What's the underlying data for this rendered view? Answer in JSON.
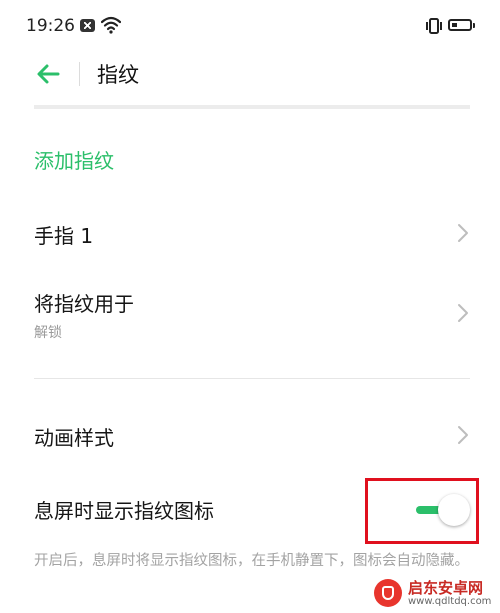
{
  "status_bar": {
    "time": "19:26"
  },
  "toolbar": {
    "title": "指纹"
  },
  "add_fingerprint": "添加指纹",
  "rows": [
    {
      "title": "手指 1"
    },
    {
      "title": "将指纹用于",
      "subtitle": "解锁"
    },
    {
      "title": "动画样式"
    }
  ],
  "screen_off_icon": {
    "title": "息屏时显示指纹图标",
    "enabled": true,
    "description": "开启后，息屏时将显示指纹图标，在手机静置下，图标会自动隐藏。"
  },
  "watermark": {
    "name": "启东安卓网",
    "url": "www.qdltdq.com"
  },
  "colors": {
    "accent": "#2bbf6a",
    "highlight": "#e0101e"
  }
}
